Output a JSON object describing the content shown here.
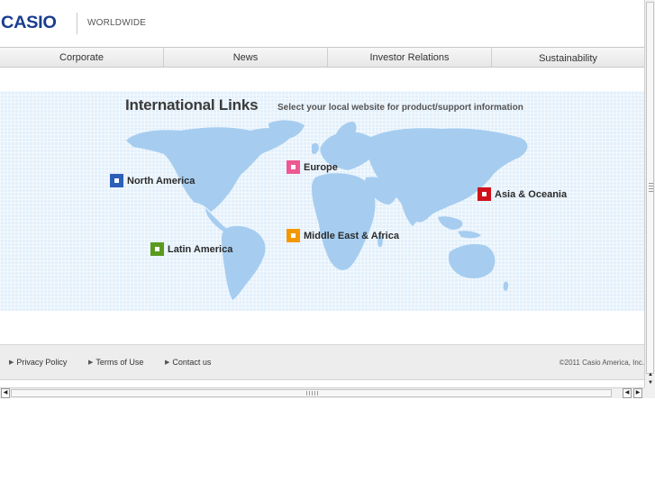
{
  "header": {
    "logo_text": "CASIO",
    "section_title": "WORLDWIDE"
  },
  "nav": {
    "items": [
      {
        "label": "Corporate"
      },
      {
        "label": "News"
      },
      {
        "label": "Investor Relations"
      },
      {
        "label": "Sustainability"
      }
    ]
  },
  "map": {
    "title": "International Links",
    "subtitle": "Select your local website for product/support information",
    "regions": [
      {
        "label": "North America",
        "color": "#2d5fb8"
      },
      {
        "label": "Europe",
        "color": "#ec5a91"
      },
      {
        "label": "Asia & Oceania",
        "color": "#d0121b"
      },
      {
        "label": "Middle East & Africa",
        "color": "#f39800"
      },
      {
        "label": "Latin America",
        "color": "#5a9a1e"
      }
    ]
  },
  "footer": {
    "links": [
      {
        "label": "Privacy Policy"
      },
      {
        "label": "Terms of Use"
      },
      {
        "label": "Contact us"
      }
    ],
    "copyright": "©2011 Casio America, Inc."
  },
  "colors": {
    "brand": "#1b3d8f",
    "map_background": "#e3f0fb",
    "land": "#a6cdf0"
  },
  "icons": {
    "nav_arrow": "right-triangle-icon",
    "scroll_up": "up-arrow-icon",
    "scroll_down": "down-arrow-icon",
    "scroll_left": "left-arrow-icon",
    "scroll_right": "right-arrow-icon"
  }
}
